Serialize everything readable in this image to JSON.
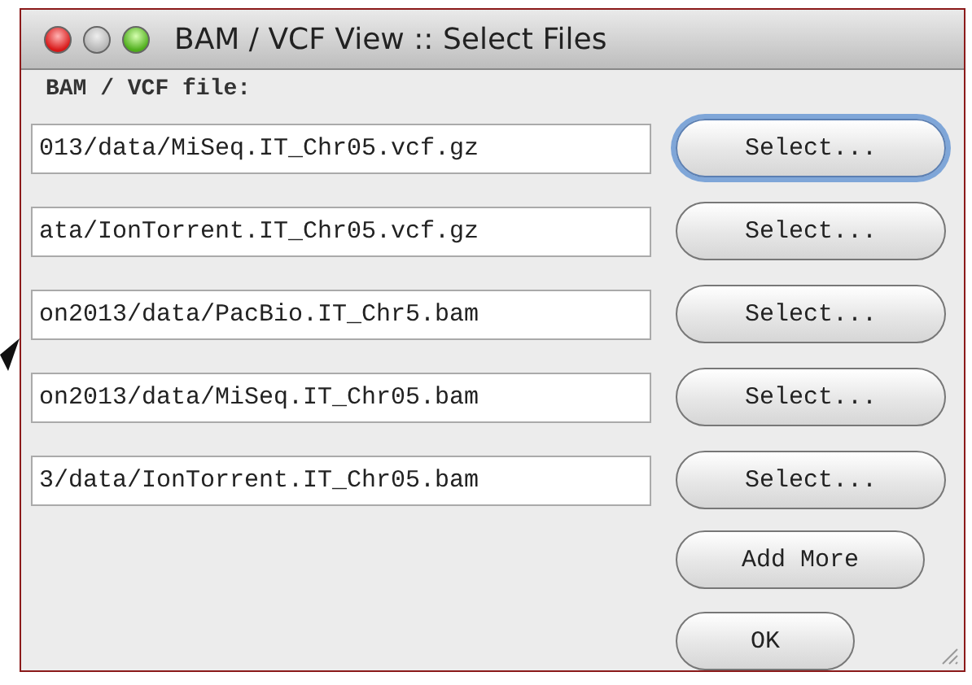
{
  "window": {
    "title": "BAM / VCF View :: Select Files"
  },
  "label": "BAM / VCF file:",
  "files": [
    {
      "path": "013/data/MiSeq.IT_Chr05.vcf.gz",
      "button": "Select...",
      "focused": true
    },
    {
      "path": "ata/IonTorrent.IT_Chr05.vcf.gz",
      "button": "Select...",
      "focused": false
    },
    {
      "path": "on2013/data/PacBio.IT_Chr5.bam",
      "button": "Select...",
      "focused": false
    },
    {
      "path": "on2013/data/MiSeq.IT_Chr05.bam",
      "button": "Select...",
      "focused": false
    },
    {
      "path": "3/data/IonTorrent.IT_Chr05.bam",
      "button": "Select...",
      "focused": false
    }
  ],
  "actions": [
    {
      "label": "Add More"
    },
    {
      "label": "OK"
    }
  ]
}
